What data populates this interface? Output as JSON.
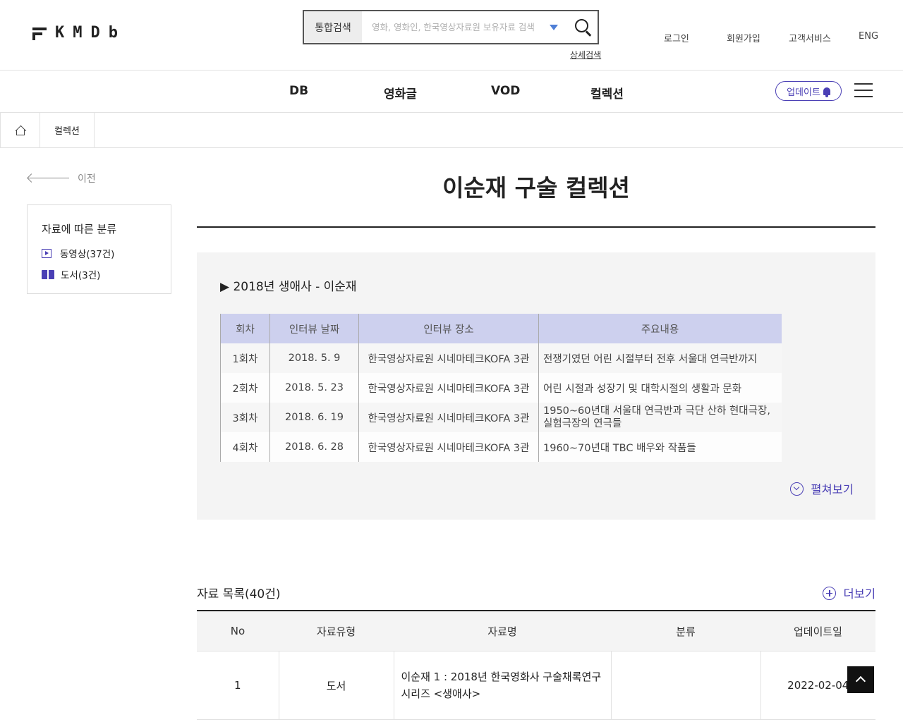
{
  "header": {
    "logo_text": "KMDb",
    "search_type": "통합검색",
    "search_placeholder": "영화, 영화인, 한국영상자료원 보유자료 검색",
    "advanced_search": "상세검색",
    "util_links": [
      "로그인",
      "회원가입",
      "고객서비스",
      "ENG"
    ]
  },
  "nav": {
    "items": [
      "DB",
      "영화글",
      "VOD",
      "컬렉션"
    ],
    "update_label": "업데이트"
  },
  "breadcrumb": {
    "current": "컬렉션"
  },
  "sidebar": {
    "back_label": "이전",
    "box_title": "자료에 따른 분류",
    "items": [
      {
        "label": "동영상(37건)",
        "icon": "video-icon"
      },
      {
        "label": "도서(3건)",
        "icon": "book-icon"
      }
    ]
  },
  "main": {
    "title": "이순재 구술 컬렉션",
    "intro": {
      "heading": "▶ 2018년 생애사 - 이순재",
      "table_headers": [
        "회차",
        "인터뷰 날짜",
        "인터뷰 장소",
        "주요내용"
      ],
      "rows": [
        [
          "1회차",
          "2018. 5. 9",
          "한국영상자료원 시네마테크KOFA 3관",
          "전쟁기였던 어린 시절부터 전후 서울대 연극반까지"
        ],
        [
          "2회차",
          "2018. 5. 23",
          "한국영상자료원 시네마테크KOFA 3관",
          "어린 시절과 성장기 및 대학시절의 생활과 문화"
        ],
        [
          "3회차",
          "2018. 6. 19",
          "한국영상자료원 시네마테크KOFA 3관",
          "1950~60년대 서울대 연극반과 극단 산하 현대극장, 실험극장의 연극들"
        ],
        [
          "4회차",
          "2018. 6. 28",
          "한국영상자료원 시네마테크KOFA 3관",
          "1960~70년대 TBC 배우와 작품들"
        ]
      ],
      "expand_label": "펼쳐보기"
    },
    "list": {
      "title": "자료 목록(40건)",
      "more_label": "더보기",
      "columns": [
        "No",
        "자료유형",
        "자료명",
        "분류",
        "업데이트일"
      ],
      "rows": [
        {
          "no": "1",
          "type": "도서",
          "name": "이순재 1 : 2018년 한국영화사 구술채록연구 시리즈 <생애사>",
          "category": "",
          "updated": "2022-02-04"
        }
      ]
    }
  },
  "colors": {
    "accent": "#4a3fb5",
    "table_header": "#cdd0ee",
    "search_arrow": "#4f7fd6"
  }
}
